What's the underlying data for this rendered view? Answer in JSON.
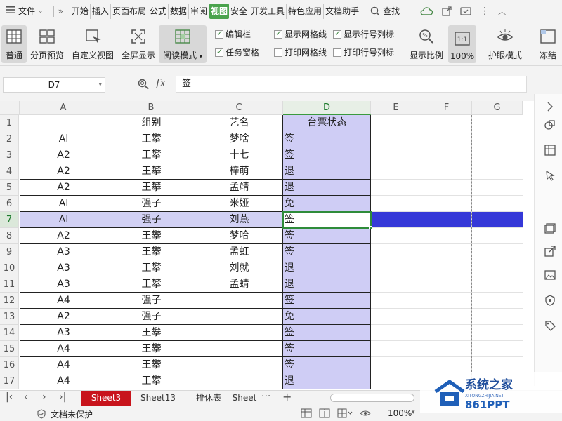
{
  "menubar": {
    "file_label": "文件",
    "items": [
      "开始",
      "插入",
      "页面布局",
      "公式",
      "数据",
      "审阅",
      "视图",
      "安全",
      "开发工具",
      "特色应用",
      "文档助手"
    ],
    "active_index": 6,
    "search_label": "查找"
  },
  "ribbon": {
    "buttons": {
      "normal": "普通",
      "page_break": "分页预览",
      "custom_view": "自定义视图",
      "fullscreen": "全屏显示",
      "read_mode": "阅读模式",
      "zoom_ratio": "显示比例",
      "zoom_100": "100%",
      "eye_mode": "护眼模式",
      "freeze": "冻结"
    },
    "checkboxes": [
      {
        "label": "编辑栏",
        "checked": true
      },
      {
        "label": "任务窗格",
        "checked": true
      },
      {
        "label": "显示网格线",
        "checked": true
      },
      {
        "label": "打印网格线",
        "checked": false
      },
      {
        "label": "显示行号列标",
        "checked": true
      },
      {
        "label": "打印行号列标",
        "checked": false
      }
    ]
  },
  "formula_bar": {
    "cell_ref": "D7",
    "fx": "fx",
    "value": "签"
  },
  "grid": {
    "columns": [
      "A",
      "B",
      "C",
      "D",
      "E",
      "F",
      "G"
    ],
    "selected_column": "D",
    "selected_row": 7,
    "rows": [
      {
        "n": "1",
        "a": "",
        "b": "组别",
        "c": "艺名",
        "d": "台票状态"
      },
      {
        "n": "2",
        "a": "Al",
        "b": "王攀",
        "c": "梦啥",
        "d": "签"
      },
      {
        "n": "3",
        "a": "A2",
        "b": "王攀",
        "c": "十七",
        "d": "签"
      },
      {
        "n": "4",
        "a": "A2",
        "b": "王攀",
        "c": "梓萌",
        "d": "退"
      },
      {
        "n": "5",
        "a": "A2",
        "b": "王攀",
        "c": "孟靖",
        "d": "退"
      },
      {
        "n": "6",
        "a": "Al",
        "b": "强子",
        "c": "米娅",
        "d": "免"
      },
      {
        "n": "7",
        "a": "Al",
        "b": "强子",
        "c": "刘燕",
        "d": "签"
      },
      {
        "n": "8",
        "a": "A2",
        "b": "王攀",
        "c": "梦哈",
        "d": "签"
      },
      {
        "n": "9",
        "a": "A3",
        "b": "王攀",
        "c": "孟虹",
        "d": "签"
      },
      {
        "n": "10",
        "a": "A3",
        "b": "王攀",
        "c": "刘就",
        "d": "退"
      },
      {
        "n": "11",
        "a": "A3",
        "b": "王攀",
        "c": "孟蜻",
        "d": "退"
      },
      {
        "n": "12",
        "a": "A4",
        "b": "强子",
        "c": "",
        "d": "签"
      },
      {
        "n": "13",
        "a": "A2",
        "b": "强子",
        "c": "",
        "d": "免"
      },
      {
        "n": "14",
        "a": "A3",
        "b": "王攀",
        "c": "",
        "d": "签"
      },
      {
        "n": "15",
        "a": "A4",
        "b": "王攀",
        "c": "",
        "d": "签"
      },
      {
        "n": "16",
        "a": "A4",
        "b": "王攀",
        "c": "",
        "d": "签"
      },
      {
        "n": "17",
        "a": "A4",
        "b": "王攀",
        "c": "",
        "d": "退"
      }
    ]
  },
  "sheet_tabs": {
    "tabs": [
      "Sheet3",
      "Sheet13",
      "排休表",
      "Sheet"
    ],
    "active_index": 0,
    "more": "···",
    "add": "+"
  },
  "statusbar": {
    "protect_label": "文档未保护",
    "zoom": "100%"
  },
  "watermark": {
    "text1": "系统之家",
    "text2": "XITONGZHIJIA.NET",
    "logo_text": "861PPT"
  },
  "colors": {
    "menu_active_bg": "#4aa34d",
    "column_d_fill": "#cfcdf5",
    "row7_fill": "#d2d1f4",
    "row7_right_fill": "#3538d8",
    "active_cell_border": "#2e8b3a",
    "sheet_tab_active": "#c8141c"
  }
}
